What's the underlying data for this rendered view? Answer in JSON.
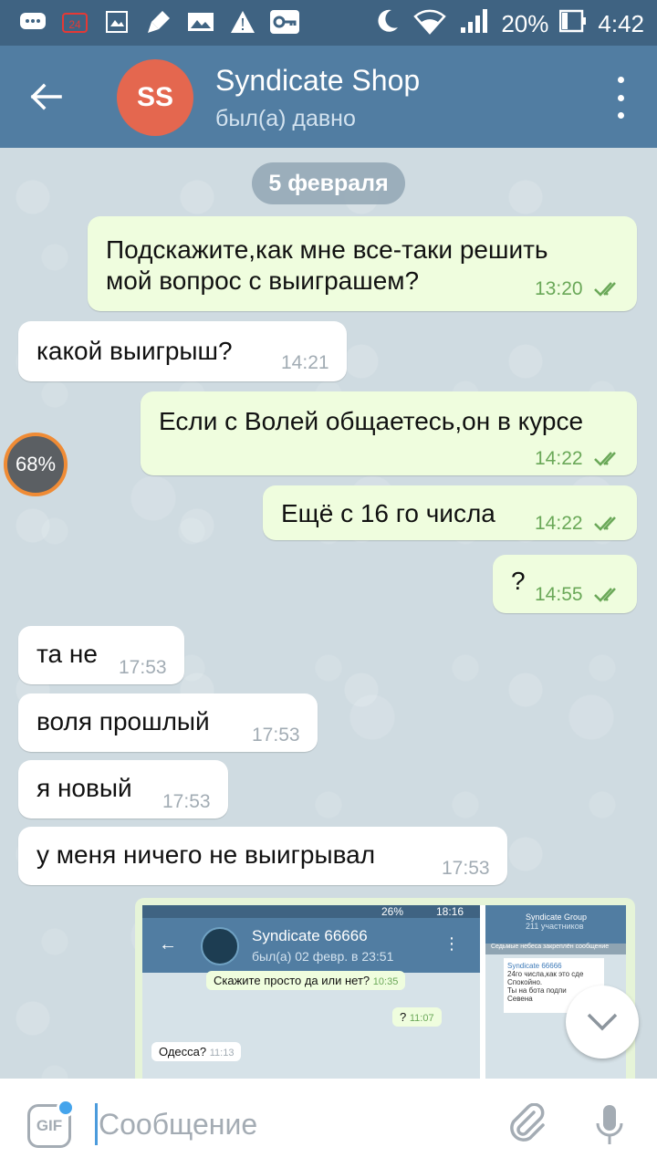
{
  "status_bar": {
    "battery": "20%",
    "time": "4:42",
    "icons": [
      "messages-icon",
      "calendar-icon",
      "image-icon",
      "cleaner-icon",
      "gallery-icon",
      "warning-icon",
      "vpn-key-icon"
    ],
    "right_icons": [
      "moon-icon",
      "wifi-icon",
      "signal-icon",
      "battery-icon"
    ],
    "notif_badge": "24"
  },
  "header": {
    "avatar_initials": "SS",
    "avatar_color": "#e4674f",
    "title": "Syndicate Shop",
    "status": "был(а) давно"
  },
  "chat": {
    "date_label": "5 февраля",
    "progress_label": "68%",
    "messages": [
      {
        "dir": "out",
        "text_line1": "Подскажите,как мне все-таки решить",
        "text_line2": "мой вопрос с выиграшем?",
        "time": "13:20"
      },
      {
        "dir": "in",
        "text": "какой выигрыш?",
        "time": "14:21"
      },
      {
        "dir": "out",
        "text": "Если с Волей общаетесь,он в курсе",
        "time": "14:22"
      },
      {
        "dir": "out",
        "text": "Ещё с 16 го  числа",
        "time": "14:22"
      },
      {
        "dir": "out",
        "text": "?",
        "time": "14:55"
      },
      {
        "dir": "in",
        "text": "та не",
        "time": "17:53"
      },
      {
        "dir": "in",
        "text": "воля прошлый",
        "time": "17:53"
      },
      {
        "dir": "in",
        "text": "я новый",
        "time": "17:53"
      },
      {
        "dir": "in",
        "text": "у меня ничего не выигрывал",
        "time": "17:53"
      }
    ],
    "photo_preview": {
      "status_battery": "26%",
      "status_time": "18:16",
      "title": "Syndicate 66666",
      "subtitle": "был(а) 02 февр. в 23:51",
      "msg_top": "Скажите просто да или нет?",
      "msg_top_time": "10:35",
      "msg_q": "?",
      "msg_q_time": "11:07",
      "msg_in": "Одесса?",
      "msg_in_time": "11:13",
      "right_title": "Syndicate Group",
      "right_sub": "211 участников",
      "right_pin": "Седьмые небеса закреплён сообщение",
      "right_card_1": "Syndicate 66666",
      "right_card_2": "24го числа,как это сде",
      "right_card_3": "Спокойно.",
      "right_card_4": "Ты на бота подпи",
      "right_card_5": "Севена"
    }
  },
  "input": {
    "placeholder": "Сообщение",
    "gif_label": "GIF"
  },
  "colors": {
    "toolbar": "#517da2",
    "status_bar": "#3f6382",
    "out_bubble": "#effdde",
    "in_bubble": "#ffffff",
    "out_time": "#6aa858",
    "accent": "#4b9bdc"
  }
}
